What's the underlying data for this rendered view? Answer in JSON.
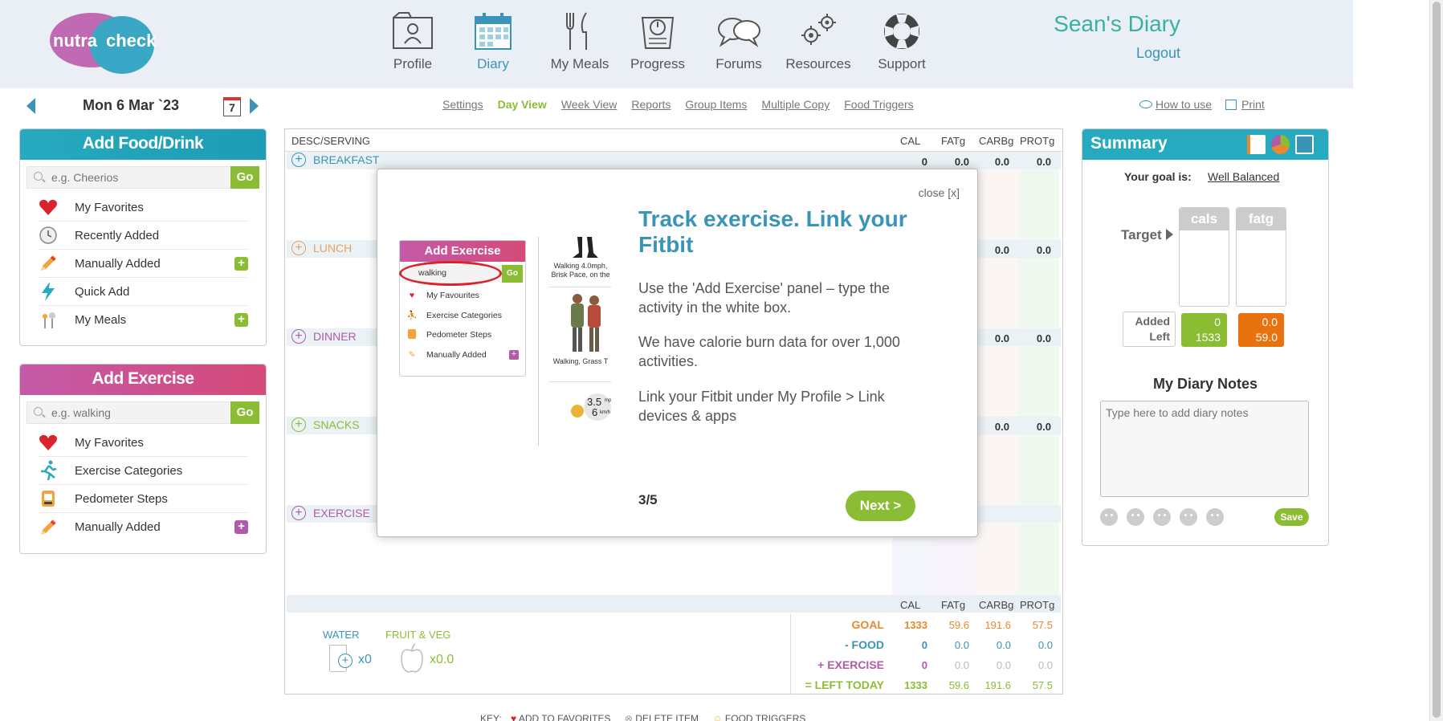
{
  "app": {
    "logo_text_1": "nutra",
    "logo_text_2": "check"
  },
  "nav": [
    {
      "label": "Profile",
      "icon": "profile-icon"
    },
    {
      "label": "Diary",
      "icon": "calendar-icon",
      "active": true
    },
    {
      "label": "My Meals",
      "icon": "cutlery-icon"
    },
    {
      "label": "Progress",
      "icon": "scales-icon"
    },
    {
      "label": "Forums",
      "icon": "speech-bubbles-icon"
    },
    {
      "label": "Resources",
      "icon": "gears-icon"
    },
    {
      "label": "Support",
      "icon": "lifebuoy-icon"
    }
  ],
  "user": {
    "diary_title": "Sean's Diary",
    "logout": "Logout"
  },
  "date": {
    "label": "Mon 6 Mar `23",
    "calendar_day": "7"
  },
  "subnav": [
    "Settings",
    "Day View",
    "Week View",
    "Reports",
    "Group Items",
    "Multiple Copy",
    "Food Triggers"
  ],
  "help": {
    "how_to": "How to use",
    "print": "Print"
  },
  "add_food": {
    "title": "Add Food/Drink",
    "placeholder": "e.g. Cheerios",
    "go": "Go",
    "items": [
      "My Favorites",
      "Recently Added",
      "Manually Added",
      "Quick Add",
      "My Meals"
    ]
  },
  "add_exercise": {
    "title": "Add Exercise",
    "placeholder": "e.g. walking",
    "go": "Go",
    "items": [
      "My Favorites",
      "Exercise Categories",
      "Pedometer Steps",
      "Manually Added"
    ]
  },
  "diary": {
    "headers": [
      "DESC/SERVING",
      "CAL",
      "FATg",
      "CARBg",
      "PROTg"
    ],
    "meals": [
      {
        "name": "BREAKFAST",
        "color": "#3a94b8",
        "values": [
          "0",
          "0.0",
          "0.0",
          "0.0"
        ]
      },
      {
        "name": "LUNCH",
        "color": "#e8a35a",
        "values": [
          "",
          "",
          "0.0",
          "0.0"
        ]
      },
      {
        "name": "DINNER",
        "color": "#b05aa8",
        "values": [
          "",
          "",
          "0.0",
          "0.0"
        ]
      },
      {
        "name": "SNACKS",
        "color": "#8bbd34",
        "values": [
          "",
          "",
          "0.0",
          "0.0"
        ]
      },
      {
        "name": "EXERCISE",
        "color": "#b05aa8"
      }
    ],
    "water_label": "WATER",
    "water_value": "x0",
    "fruit_label": "FRUIT & VEG",
    "fruit_value": "x0.0",
    "totals": [
      {
        "label": "GOAL",
        "color": "#e8892e",
        "values": [
          "1333",
          "59.6",
          "191.6",
          "57.5"
        ]
      },
      {
        "label": "- FOOD",
        "color": "#3a94b8",
        "values": [
          "0",
          "0.0",
          "0.0",
          "0.0"
        ]
      },
      {
        "label": "+ EXERCISE",
        "color": "#b05aa8",
        "values": [
          "0",
          "0.0",
          "0.0",
          "0.0"
        ]
      },
      {
        "label": "= LEFT TODAY",
        "color": "#8bbd34",
        "values": [
          "1333",
          "59.6",
          "191.6",
          "57.5"
        ]
      }
    ]
  },
  "modal": {
    "close": "close [x]",
    "title": "Track exercise. Link your Fitbit",
    "p1": "Use the 'Add Exercise' panel – type the activity in the white box.",
    "p2": "We have calorie burn data for over 1,000 activities.",
    "p3": "Link your Fitbit under My Profile > Link devices & apps",
    "step": "3/5",
    "next": "Next >",
    "mini_title": "Add Exercise",
    "mini_search": "walking",
    "mini_go": "Go",
    "mini_items": [
      "My Favourites",
      "Exercise Categories",
      "Pedometer Steps",
      "Manually Added"
    ],
    "img1_caption": "Walking 4.0mph, Brisk Pace, on the",
    "img2_caption": "Walking, Grass T",
    "img3_speed": "3.5",
    "img3_unit1": "mph",
    "img3_speed2": "6",
    "img3_unit2": "km/h"
  },
  "summary": {
    "title": "Summary",
    "goal_label": "Your goal is:",
    "goal_value": "Well Balanced",
    "target_label": "Target",
    "col1": "cals",
    "col2": "fatg",
    "added_label": "Added",
    "left_label": "Left",
    "cals_added": "0",
    "cals_left": "1533",
    "fat_added": "0.0",
    "fat_left": "59.0",
    "notes_title": "My Diary Notes",
    "notes_placeholder": "Type here to add diary notes",
    "save": "Save"
  },
  "key": {
    "label": "KEY:",
    "fav": "ADD TO FAVORITES",
    "del": "DELETE ITEM",
    "trig": "FOOD TRIGGERS"
  },
  "colors": {
    "green": "#8bbd34",
    "teal": "#27a9bf",
    "blue": "#3a94b8",
    "purple": "#b05aa8",
    "orange": "#e8892e"
  }
}
